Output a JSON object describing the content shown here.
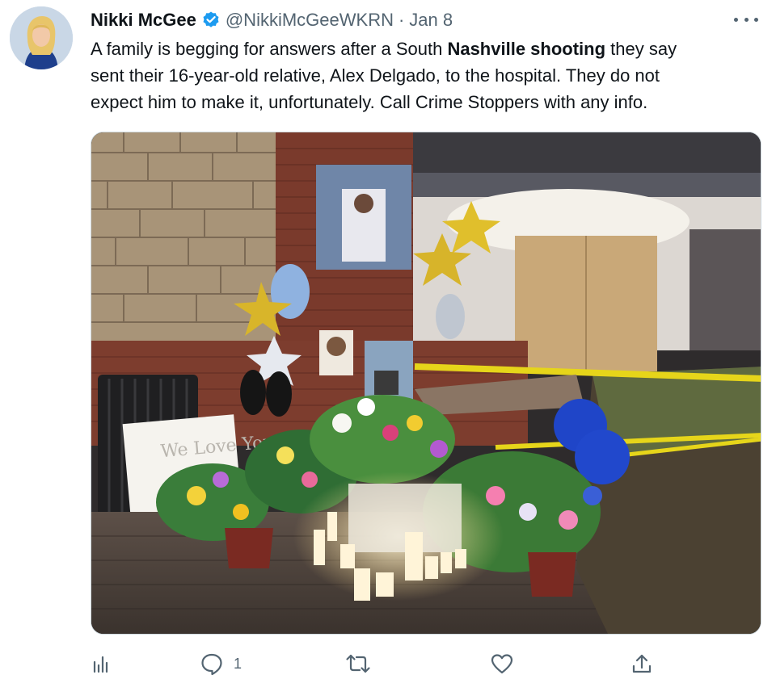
{
  "author": {
    "display_name": "Nikki McGee",
    "handle": "@NikkiMcGeeWKRN",
    "separator": "·",
    "date": "Jan 8",
    "verified": true
  },
  "tweet": {
    "text_lines": [
      {
        "pre": "A family is begging for answers after a South ",
        "bold": "Nashville shooting",
        "post": " they say"
      },
      {
        "pre": "sent their 16-year-old relative, Alex Delgado, to the hospital. They do not",
        "bold": "",
        "post": ""
      },
      {
        "pre": "expect him to make it, unfortunately. Call Crime Stoppers with any info.",
        "bold": "",
        "post": ""
      }
    ]
  },
  "media": {
    "photo_sign_text": "We Love You"
  },
  "actions": {
    "analytics": {
      "icon": "bar-chart-icon"
    },
    "reply": {
      "icon": "speech-bubble-icon",
      "count": "1"
    },
    "retweet": {
      "icon": "retweet-icon"
    },
    "like": {
      "icon": "heart-icon"
    },
    "share": {
      "icon": "share-upload-icon"
    }
  },
  "colors": {
    "verified_blue": "#1d9bf0",
    "secondary_text": "#536471",
    "primary_text": "#0f1419"
  }
}
